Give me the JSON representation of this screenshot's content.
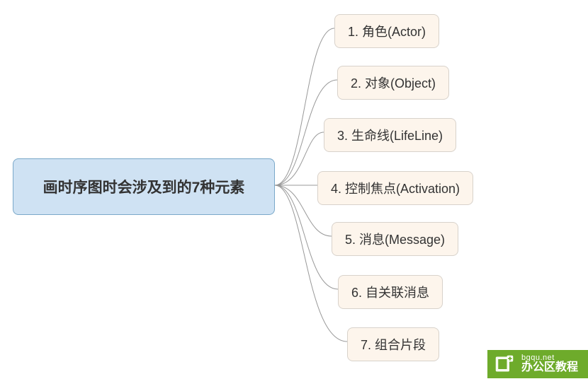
{
  "mindmap": {
    "root": {
      "label": "画时序图时会涉及到的7种元素"
    },
    "children": [
      {
        "label": "1. 角色(Actor)"
      },
      {
        "label": "2. 对象(Object)"
      },
      {
        "label": "3. 生命线(LifeLine)"
      },
      {
        "label": "4. 控制焦点(Activation)"
      },
      {
        "label": "5. 消息(Message)"
      },
      {
        "label": "6. 自关联消息"
      },
      {
        "label": "7. 组合片段"
      }
    ]
  },
  "watermark": {
    "url": "bgqu.net",
    "title": "办公区教程"
  }
}
